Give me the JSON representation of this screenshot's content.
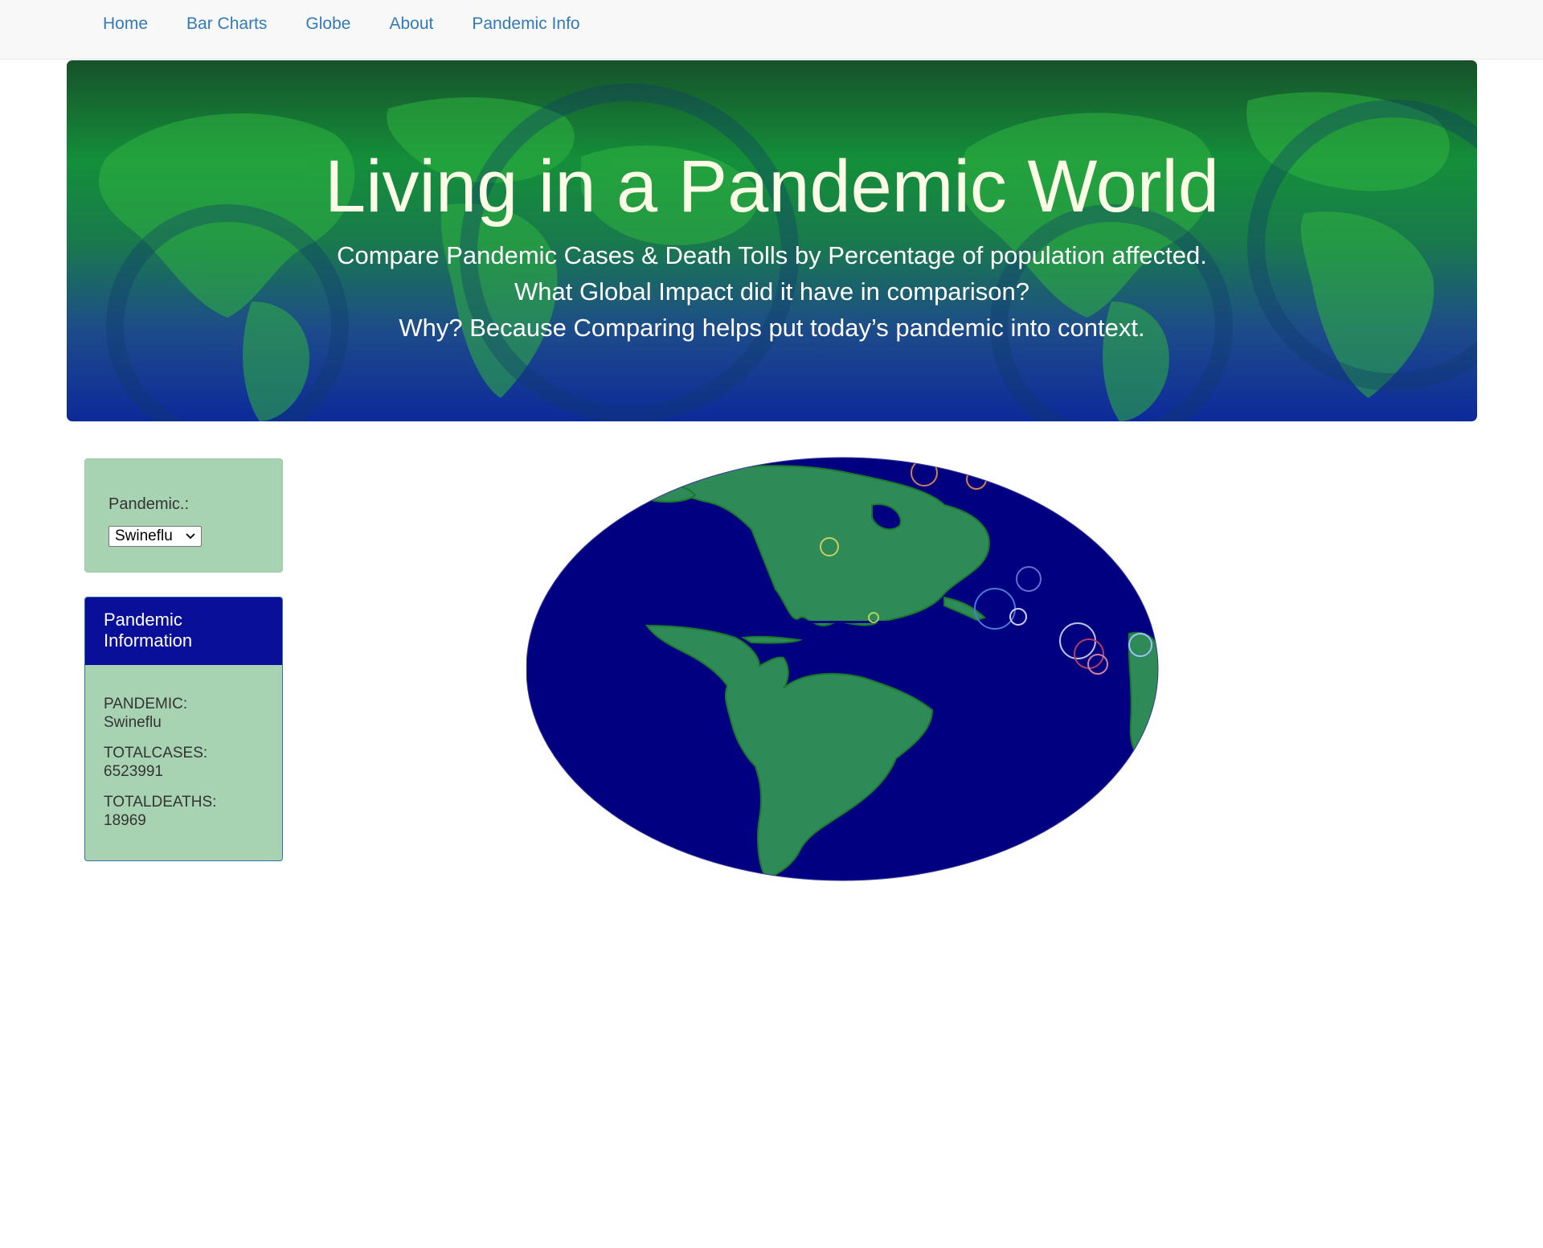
{
  "nav": {
    "items": [
      "Home",
      "Bar Charts",
      "Globe",
      "About",
      "Pandemic Info"
    ]
  },
  "hero": {
    "title": "Living in a Pandemic World",
    "lines": [
      "Compare Pandemic Cases & Death Tolls by Percentage of population affected.",
      "What Global Impact did it have in comparison?",
      "Why? Because Comparing helps put today’s pandemic into context."
    ]
  },
  "selector": {
    "label": "Pandemic.:",
    "selected": "Swineflu"
  },
  "info_panel": {
    "heading": "Pandemic Information",
    "items": [
      {
        "key": "PANDEMIC:",
        "value": "Swineflu"
      },
      {
        "key": "TOTALCASES:",
        "value": "6523991"
      },
      {
        "key": "TOTALDEATHS:",
        "value": "18969"
      }
    ]
  },
  "colors": {
    "ocean": "#000080",
    "land": "#2e8b57",
    "panel_bg": "#a8d3b2",
    "panel_heading": "#0a0f99",
    "link": "#337ab7"
  }
}
